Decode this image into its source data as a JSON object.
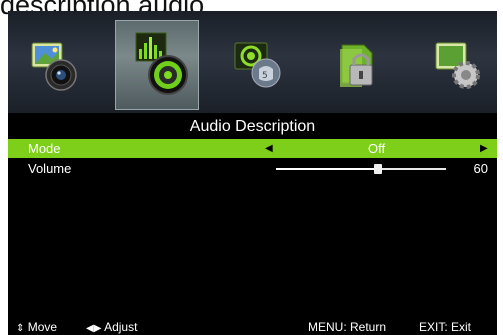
{
  "caption": "description audio.",
  "menu_tabs": [
    {
      "icon": "picture-icon"
    },
    {
      "icon": "sound-icon",
      "selected": true
    },
    {
      "icon": "tv-channel-icon"
    },
    {
      "icon": "lock-icon"
    },
    {
      "icon": "settings-gear-icon"
    }
  ],
  "page_title": "Audio Description",
  "rows": {
    "mode": {
      "label": "Mode",
      "value": "Off"
    },
    "volume": {
      "label": "Volume",
      "value": "60",
      "level": 0.6
    }
  },
  "footer": {
    "move": "Move",
    "adjust": "Adjust",
    "menu": "MENU: Return",
    "exit": "EXIT: Exit"
  },
  "colors": {
    "highlight": "#7ecf19",
    "screen_bg": "#000000",
    "text": "#ffffff"
  }
}
